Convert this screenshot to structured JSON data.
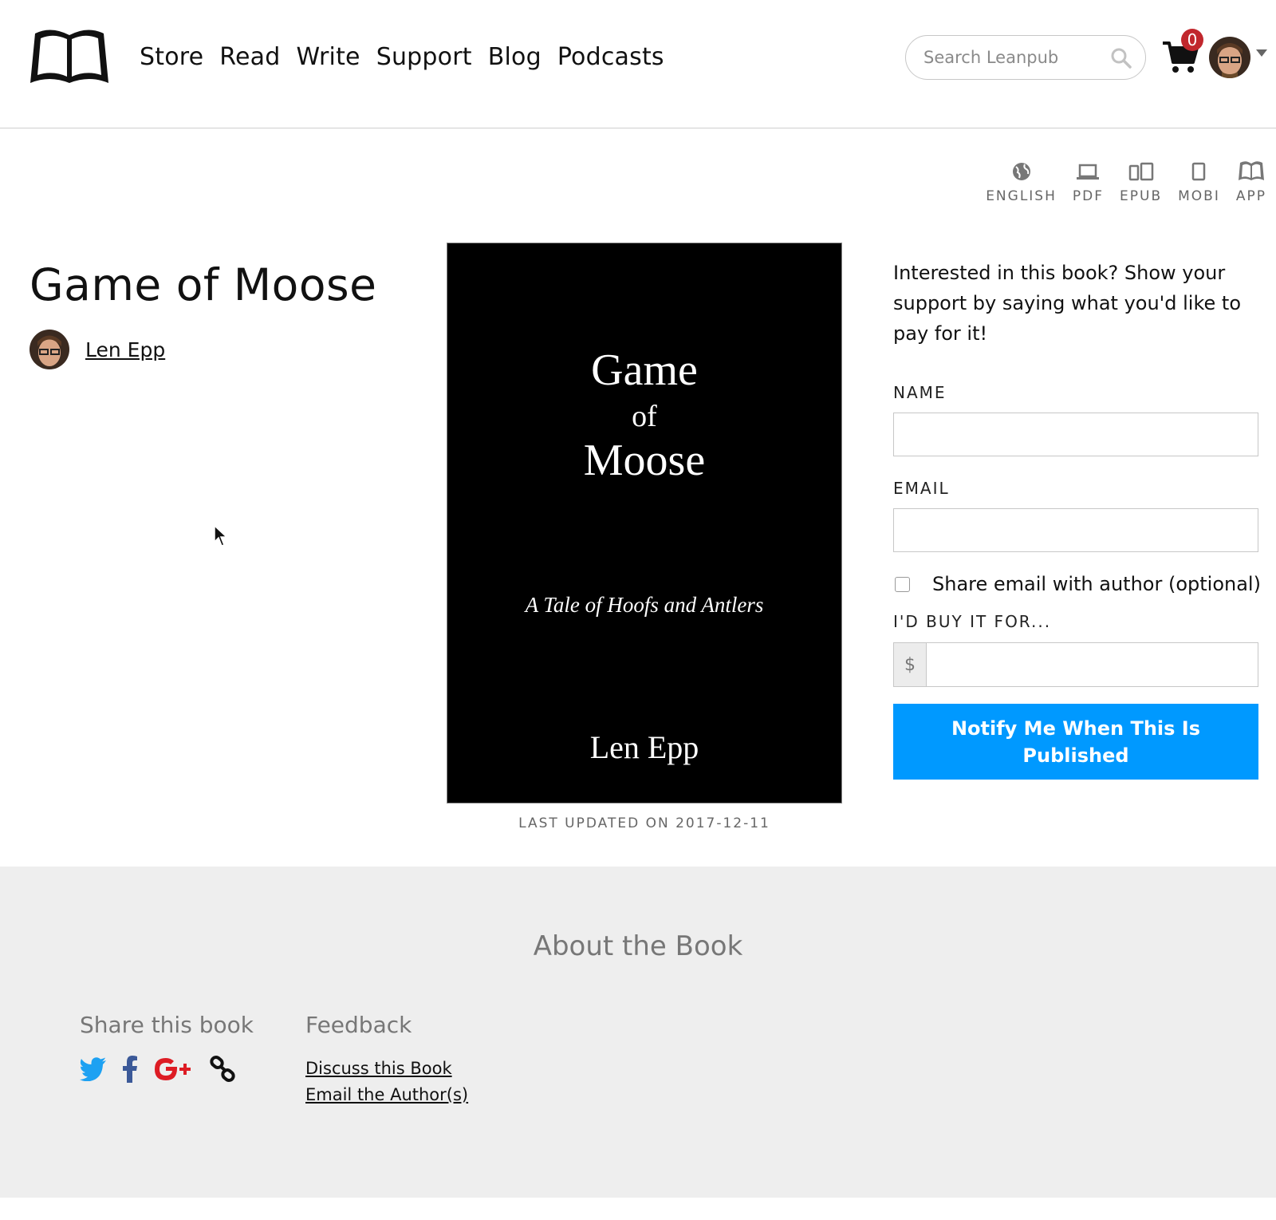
{
  "nav": {
    "items": [
      "Store",
      "Read",
      "Write",
      "Support",
      "Blog",
      "Podcasts"
    ]
  },
  "search": {
    "placeholder": "Search Leanpub"
  },
  "cart": {
    "count": "0"
  },
  "formats": [
    {
      "label": "ENGLISH",
      "icon": "globe-icon"
    },
    {
      "label": "PDF",
      "icon": "laptop-icon"
    },
    {
      "label": "EPUB",
      "icon": "devices-icon"
    },
    {
      "label": "MOBI",
      "icon": "tablet-icon"
    },
    {
      "label": "APP",
      "icon": "book-app-icon"
    }
  ],
  "book": {
    "title": "Game of Moose",
    "author": "Len Epp",
    "cover": {
      "line1": "Game",
      "line2": "of",
      "line3": "Moose",
      "subtitle": "A Tale of Hoofs and Antlers",
      "author": "Len Epp"
    },
    "last_updated": "LAST UPDATED ON 2017-12-11"
  },
  "form": {
    "pitch": "Interested in this book? Show your support by saying what you'd like to pay for it!",
    "name_label": "NAME",
    "email_label": "EMAIL",
    "share_label": "Share email with author (optional)",
    "price_label": "I'D BUY IT FOR...",
    "currency": "$",
    "button": "Notify Me When This Is Published"
  },
  "about": {
    "title": "About the Book",
    "share_title": "Share this book",
    "feedback_title": "Feedback",
    "feedback_links": [
      "Discuss this Book",
      "Email the Author(s)"
    ]
  },
  "colors": {
    "accent": "#0099ff",
    "badge": "#c1272d",
    "twitter": "#1da1f2",
    "facebook": "#3b5998",
    "google": "#dd1c24"
  }
}
